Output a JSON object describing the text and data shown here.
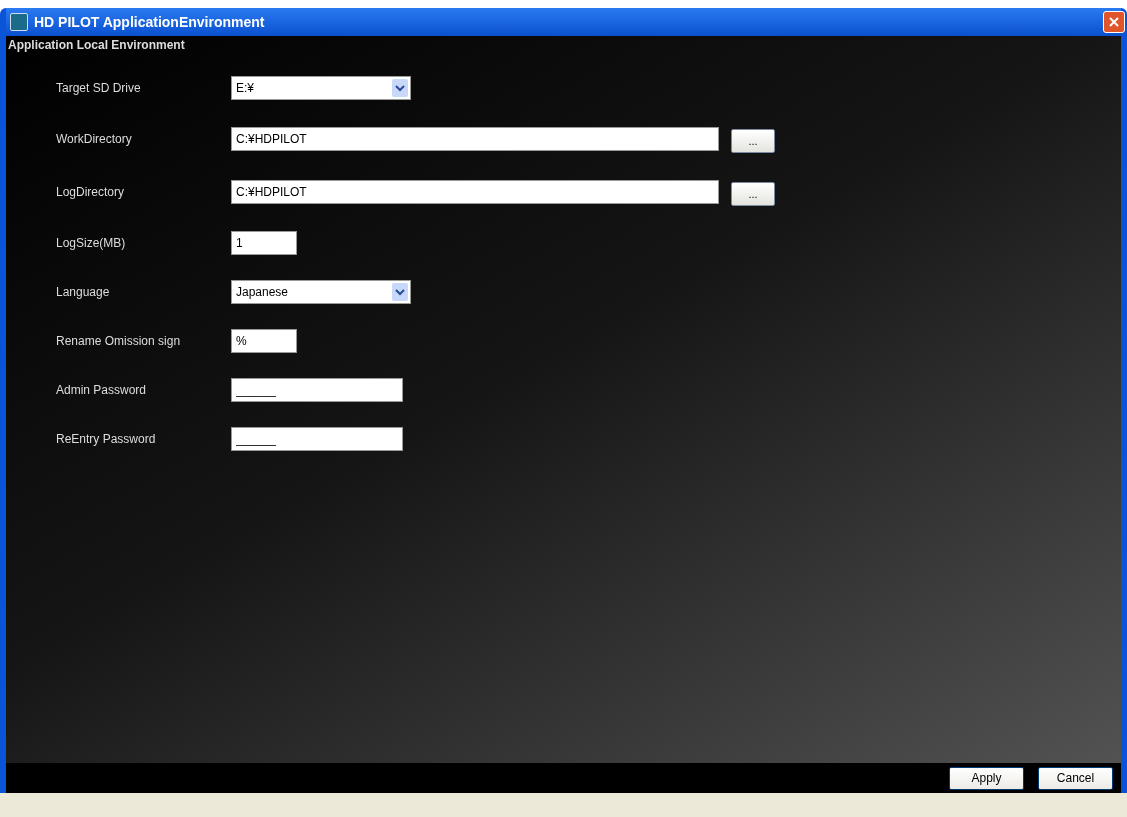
{
  "window": {
    "title": "HD PILOT ApplicationEnvironment"
  },
  "section_title": "Application Local Environment",
  "fields": [
    {
      "label": "Target SD Drive",
      "kind": "dropdown",
      "value": "E:¥"
    },
    {
      "label": "WorkDirectory",
      "kind": "path",
      "value": "C:¥HDPILOT",
      "browse": "..."
    },
    {
      "label": "LogDirectory",
      "kind": "path",
      "value": "C:¥HDPILOT",
      "browse": "..."
    },
    {
      "label": "LogSize(MB)",
      "kind": "short",
      "value": "1"
    },
    {
      "label": "Language",
      "kind": "dropdown",
      "value": "Japanese"
    },
    {
      "label": "Rename Omission sign",
      "kind": "short",
      "value": "%"
    },
    {
      "label": "Admin Password",
      "kind": "password",
      "value": "______"
    },
    {
      "label": "ReEntry Password",
      "kind": "password",
      "value": "______"
    }
  ],
  "buttons": [
    "Apply",
    "Cancel"
  ]
}
